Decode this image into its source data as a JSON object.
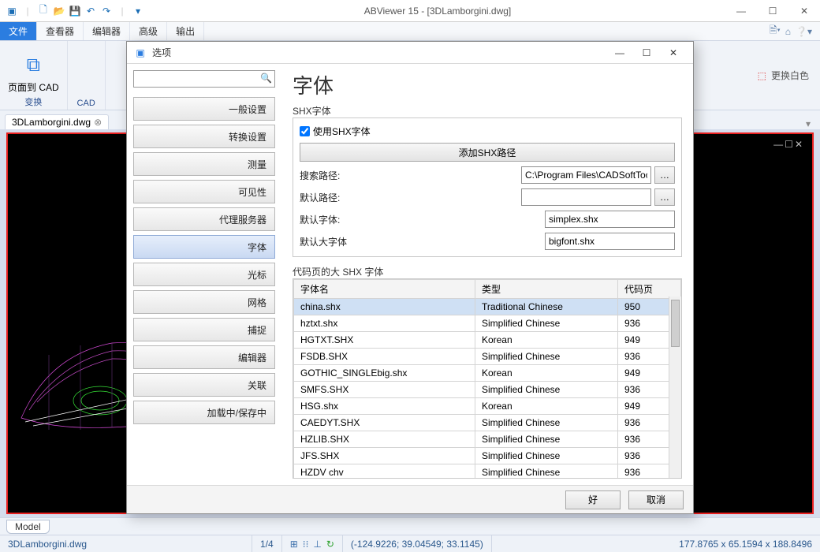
{
  "window": {
    "title": "ABViewer 15 - [3DLamborgini.dwg]"
  },
  "menu": {
    "tabs": [
      "文件",
      "查看器",
      "编辑器",
      "高级",
      "输出"
    ],
    "active": 0
  },
  "ribbon": {
    "page_to_cad": "页面到 CAD",
    "cad_group": "CAD",
    "convert": "变换",
    "change_bg": "更换白色"
  },
  "doc_tab": {
    "name": "3DLamborgini.dwg"
  },
  "model_tab": "Model",
  "status": {
    "filename": "3DLamborgini.dwg",
    "pages": "1/4",
    "coords": "(-124.9226; 39.04549; 33.1145)",
    "extent": "177.8765 x 65.1594 x 188.8496"
  },
  "dialog": {
    "title": "选项",
    "search_placeholder": "",
    "side": [
      "一般设置",
      "转换设置",
      "测量",
      "可见性",
      "代理服务器",
      "字体",
      "光标",
      "网格",
      "捕捉",
      "编辑器",
      "关联",
      "加载中/保存中"
    ],
    "side_selected": 5,
    "heading": "字体",
    "shx_group": "SHX字体",
    "use_shx": "使用SHX字体",
    "add_path_btn": "添加SHX路径",
    "labels": {
      "search_path": "搜索路径:",
      "default_path": "默认路径:",
      "default_font": "默认字体:",
      "default_bigfont": "默认大字体"
    },
    "values": {
      "search_path": "C:\\Program Files\\CADSoftTools\\ABVie",
      "default_path": "",
      "default_font": "simplex.shx",
      "default_bigfont": "bigfont.shx"
    },
    "table_caption": "代码页的大 SHX 字体",
    "columns": [
      "字体名",
      "类型",
      "代码页"
    ],
    "rows": [
      {
        "name": "china.shx",
        "type": "Traditional Chinese",
        "cp": "950"
      },
      {
        "name": "hztxt.shx",
        "type": "Simplified Chinese",
        "cp": "936"
      },
      {
        "name": "HGTXT.SHX",
        "type": "Korean",
        "cp": "949"
      },
      {
        "name": "FSDB.SHX",
        "type": "Simplified Chinese",
        "cp": "936"
      },
      {
        "name": "GOTHIC_SINGLEbig.shx",
        "type": "Korean",
        "cp": "949"
      },
      {
        "name": "SMFS.SHX",
        "type": "Simplified Chinese",
        "cp": "936"
      },
      {
        "name": "HSG.shx",
        "type": "Korean",
        "cp": "949"
      },
      {
        "name": "CAEDYT.SHX",
        "type": "Simplified Chinese",
        "cp": "936"
      },
      {
        "name": "HZLIB.SHX",
        "type": "Simplified Chinese",
        "cp": "936"
      },
      {
        "name": "JFS.SHX",
        "type": "Simplified Chinese",
        "cp": "936"
      },
      {
        "name": "HZDV chv",
        "type": "Simplified Chinese",
        "cp": "936"
      }
    ],
    "ok": "好",
    "cancel": "取消"
  }
}
